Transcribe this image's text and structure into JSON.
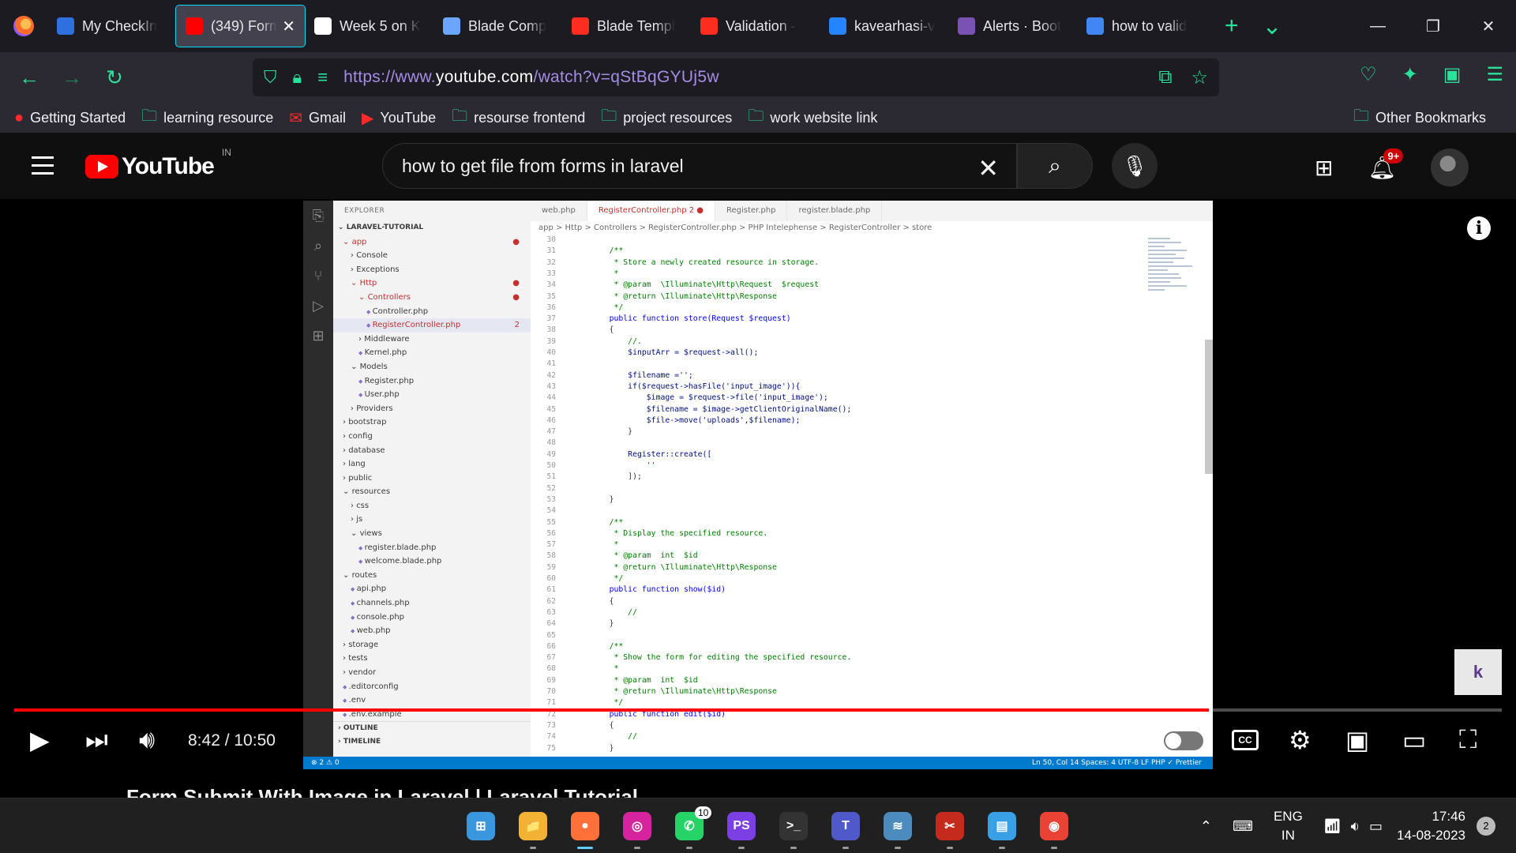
{
  "browser": {
    "tabs": [
      {
        "title": "My CheckIn",
        "favicon": "cloud-icon",
        "color": "#2f6fe0"
      },
      {
        "title": "(349) Form",
        "favicon": "youtube-icon",
        "color": "#ff0000",
        "active": true
      },
      {
        "title": "Week 5 on K",
        "favicon": "trello-icon",
        "color": "#ffffff"
      },
      {
        "title": "Blade Comp",
        "favicon": "send-icon",
        "color": "#6aa6ff"
      },
      {
        "title": "Blade Templ",
        "favicon": "laravel-icon",
        "color": "#ff2d20"
      },
      {
        "title": "Validation - ",
        "favicon": "laravel-icon",
        "color": "#ff2d20"
      },
      {
        "title": "kavearhasi-v",
        "favicon": "bitbucket-icon",
        "color": "#2684ff"
      },
      {
        "title": "Alerts · Boot",
        "favicon": "bootstrap-icon",
        "color": "#7952b3"
      },
      {
        "title": "how to valid",
        "favicon": "google-icon",
        "color": "#4285f4"
      }
    ],
    "new_tab": "+",
    "list_all_tabs": "⌄",
    "url": {
      "prefix": "https://www.",
      "domain": "youtube.com",
      "path": "/watch?v=qStBqGYUj5w"
    },
    "bookmarks": [
      {
        "label": "Getting Started",
        "icon": "firefox-icon"
      },
      {
        "label": "learning resource",
        "icon": "folder-icon"
      },
      {
        "label": "Gmail",
        "icon": "gmail-icon"
      },
      {
        "label": "YouTube",
        "icon": "youtube-icon"
      },
      {
        "label": "resourse frontend",
        "icon": "folder-icon"
      },
      {
        "label": "project resources",
        "icon": "folder-icon"
      },
      {
        "label": "work website link",
        "icon": "folder-icon"
      }
    ],
    "other_bookmarks": "Other Bookmarks"
  },
  "youtube": {
    "logo_text": "YouTube",
    "country_code": "IN",
    "search_query": "how to get file from forms in laravel",
    "notification_count": "9+",
    "player": {
      "current_time": "8:42",
      "duration": "10:50",
      "time_display": "8:42 / 10:50",
      "progress": 0.803,
      "cc_label": "CC",
      "info": "i"
    },
    "video_title": "Form Submit With Image in Laravel | Laravel Tutorial"
  },
  "vscode": {
    "explorer_title": "EXPLORER",
    "project": "LARAVEL-TUTORIAL",
    "tree": [
      {
        "label": "app",
        "depth": 0,
        "kind": "open",
        "error": true
      },
      {
        "label": "Console",
        "depth": 1,
        "kind": "closed"
      },
      {
        "label": "Exceptions",
        "depth": 1,
        "kind": "closed"
      },
      {
        "label": "Http",
        "depth": 1,
        "kind": "open",
        "error": true
      },
      {
        "label": "Controllers",
        "depth": 2,
        "kind": "open",
        "error": true
      },
      {
        "label": "Controller.php",
        "depth": 3,
        "kind": "file"
      },
      {
        "label": "RegisterController.php",
        "depth": 3,
        "kind": "file",
        "error": true,
        "selected": true,
        "badge": "2"
      },
      {
        "label": "Middleware",
        "depth": 2,
        "kind": "closed"
      },
      {
        "label": "Kernel.php",
        "depth": 2,
        "kind": "file"
      },
      {
        "label": "Models",
        "depth": 1,
        "kind": "open"
      },
      {
        "label": "Register.php",
        "depth": 2,
        "kind": "file"
      },
      {
        "label": "User.php",
        "depth": 2,
        "kind": "file"
      },
      {
        "label": "Providers",
        "depth": 1,
        "kind": "closed"
      },
      {
        "label": "bootstrap",
        "depth": 0,
        "kind": "closed"
      },
      {
        "label": "config",
        "depth": 0,
        "kind": "closed"
      },
      {
        "label": "database",
        "depth": 0,
        "kind": "closed"
      },
      {
        "label": "lang",
        "depth": 0,
        "kind": "closed"
      },
      {
        "label": "public",
        "depth": 0,
        "kind": "closed"
      },
      {
        "label": "resources",
        "depth": 0,
        "kind": "open"
      },
      {
        "label": "css",
        "depth": 1,
        "kind": "closed"
      },
      {
        "label": "js",
        "depth": 1,
        "kind": "closed"
      },
      {
        "label": "views",
        "depth": 1,
        "kind": "open"
      },
      {
        "label": "register.blade.php",
        "depth": 2,
        "kind": "file"
      },
      {
        "label": "welcome.blade.php",
        "depth": 2,
        "kind": "file"
      },
      {
        "label": "routes",
        "depth": 0,
        "kind": "open"
      },
      {
        "label": "api.php",
        "depth": 1,
        "kind": "file"
      },
      {
        "label": "channels.php",
        "depth": 1,
        "kind": "file"
      },
      {
        "label": "console.php",
        "depth": 1,
        "kind": "file"
      },
      {
        "label": "web.php",
        "depth": 1,
        "kind": "file"
      },
      {
        "label": "storage",
        "depth": 0,
        "kind": "closed"
      },
      {
        "label": "tests",
        "depth": 0,
        "kind": "closed"
      },
      {
        "label": "vendor",
        "depth": 0,
        "kind": "closed"
      },
      {
        "label": ".editorconfig",
        "depth": 0,
        "kind": "file"
      },
      {
        "label": ".env",
        "depth": 0,
        "kind": "file"
      },
      {
        "label": ".env.example",
        "depth": 0,
        "kind": "file"
      }
    ],
    "sections": [
      "OUTLINE",
      "TIMELINE"
    ],
    "editor_tabs": [
      {
        "label": "web.php"
      },
      {
        "label": "RegisterController.php 2 ●",
        "active": true
      },
      {
        "label": "Register.php"
      },
      {
        "label": "register.blade.php"
      }
    ],
    "breadcrumb": "app  >  Http  >  Controllers  >  RegisterController.php  >  PHP Intelephense  >  RegisterController  >  store",
    "code": [
      {
        "n": "30",
        "t": ""
      },
      {
        "n": "31",
        "t": "    /**",
        "c": "cmt"
      },
      {
        "n": "32",
        "t": "     * Store a newly created resource in storage.",
        "c": "cmt"
      },
      {
        "n": "33",
        "t": "     *",
        "c": "cmt"
      },
      {
        "n": "34",
        "t": "     * @param  \\Illuminate\\Http\\Request  $request",
        "c": "cmt"
      },
      {
        "n": "35",
        "t": "     * @return \\Illuminate\\Http\\Response",
        "c": "cmt"
      },
      {
        "n": "36",
        "t": "     */",
        "c": "cmt"
      },
      {
        "n": "37",
        "t": "    public function store(Request $request)",
        "c": "kw"
      },
      {
        "n": "38",
        "t": "    {"
      },
      {
        "n": "39",
        "t": "        //.",
        "c": "cmt"
      },
      {
        "n": "40",
        "t": "        $inputArr = $request->all();",
        "c": "var"
      },
      {
        "n": "41",
        "t": ""
      },
      {
        "n": "42",
        "t": "        $filename ='';",
        "c": "var"
      },
      {
        "n": "43",
        "t": "        if($request->hasFile('input_image')){",
        "c": "var"
      },
      {
        "n": "44",
        "t": "            $image = $request->file('input_image');",
        "c": "var"
      },
      {
        "n": "45",
        "t": "            $filename = $image->getClientOriginalName();",
        "c": "var"
      },
      {
        "n": "46",
        "t": "            $file->move('uploads',$filename);",
        "c": "var"
      },
      {
        "n": "47",
        "t": "        }"
      },
      {
        "n": "48",
        "t": ""
      },
      {
        "n": "49",
        "t": "        Register::create([",
        "c": "var"
      },
      {
        "n": "50",
        "t": "            ''",
        "c": "str"
      },
      {
        "n": "51",
        "t": "        ]);"
      },
      {
        "n": "52",
        "t": ""
      },
      {
        "n": "53",
        "t": "    }"
      },
      {
        "n": "54",
        "t": ""
      },
      {
        "n": "55",
        "t": "    /**",
        "c": "cmt"
      },
      {
        "n": "56",
        "t": "     * Display the specified resource.",
        "c": "cmt"
      },
      {
        "n": "57",
        "t": "     *",
        "c": "cmt"
      },
      {
        "n": "58",
        "t": "     * @param  int  $id",
        "c": "cmt"
      },
      {
        "n": "59",
        "t": "     * @return \\Illuminate\\Http\\Response",
        "c": "cmt"
      },
      {
        "n": "60",
        "t": "     */",
        "c": "cmt"
      },
      {
        "n": "61",
        "t": "    public function show($id)",
        "c": "kw"
      },
      {
        "n": "62",
        "t": "    {"
      },
      {
        "n": "63",
        "t": "        //",
        "c": "cmt"
      },
      {
        "n": "64",
        "t": "    }"
      },
      {
        "n": "65",
        "t": ""
      },
      {
        "n": "66",
        "t": "    /**",
        "c": "cmt"
      },
      {
        "n": "67",
        "t": "     * Show the form for editing the specified resource.",
        "c": "cmt"
      },
      {
        "n": "68",
        "t": "     *",
        "c": "cmt"
      },
      {
        "n": "69",
        "t": "     * @param  int  $id",
        "c": "cmt"
      },
      {
        "n": "70",
        "t": "     * @return \\Illuminate\\Http\\Response",
        "c": "cmt"
      },
      {
        "n": "71",
        "t": "     */",
        "c": "cmt"
      },
      {
        "n": "72",
        "t": "    public function edit($id)",
        "c": "kw"
      },
      {
        "n": "73",
        "t": "    {"
      },
      {
        "n": "74",
        "t": "        //",
        "c": "cmt"
      },
      {
        "n": "75",
        "t": "    }"
      }
    ],
    "status_left": "⊗ 2  ⚠ 0",
    "status_right": "Ln 50, Col 14    Spaces: 4    UTF-8    LF    PHP    ✓ Prettier"
  },
  "taskbar": {
    "apps": [
      {
        "name": "windows-start-icon",
        "glyph": "⊞",
        "color": "#3a96dd"
      },
      {
        "name": "file-explorer-icon",
        "glyph": "📁",
        "color": "#f2b233"
      },
      {
        "name": "firefox-icon",
        "glyph": "●",
        "color": "#ff7139",
        "active": true
      },
      {
        "name": "instagram-icon",
        "glyph": "◎",
        "color": "#d6249f"
      },
      {
        "name": "whatsapp-icon",
        "glyph": "✆",
        "color": "#25d366",
        "badge": "10"
      },
      {
        "name": "phpstorm-icon",
        "glyph": "PS",
        "color": "#7b3fe4"
      },
      {
        "name": "terminal-icon",
        "glyph": ">_",
        "color": "#333333"
      },
      {
        "name": "teams-icon",
        "glyph": "T",
        "color": "#5059c9"
      },
      {
        "name": "workbench-icon",
        "glyph": "≋",
        "color": "#4b8bbe"
      },
      {
        "name": "snipping-tool-icon",
        "glyph": "✂",
        "color": "#c42b1c"
      },
      {
        "name": "notepad-icon",
        "glyph": "▤",
        "color": "#3aa0e5"
      },
      {
        "name": "chrome-icon",
        "glyph": "◉",
        "color": "#ea4335"
      }
    ],
    "language": "ENG",
    "region": "IN",
    "time": "17:46",
    "date": "14-08-2023",
    "notifications": "2"
  }
}
